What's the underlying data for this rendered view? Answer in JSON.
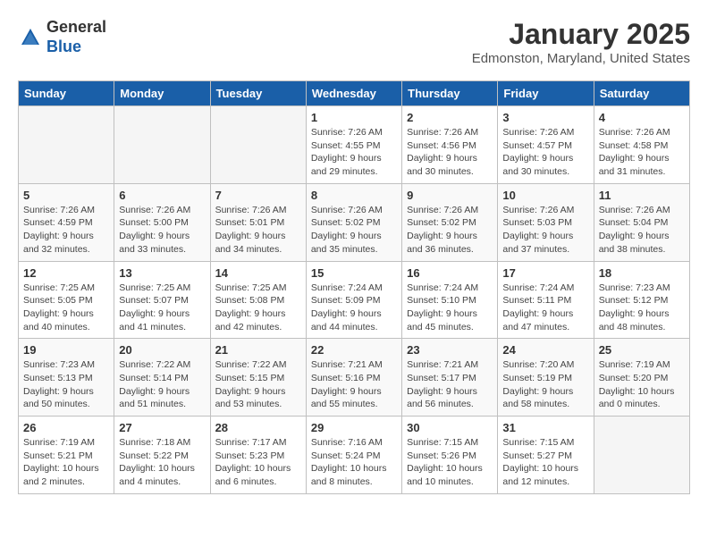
{
  "header": {
    "logo_general": "General",
    "logo_blue": "Blue",
    "month_title": "January 2025",
    "location": "Edmonston, Maryland, United States"
  },
  "columns": [
    "Sunday",
    "Monday",
    "Tuesday",
    "Wednesday",
    "Thursday",
    "Friday",
    "Saturday"
  ],
  "weeks": [
    [
      {
        "day": "",
        "info": ""
      },
      {
        "day": "",
        "info": ""
      },
      {
        "day": "",
        "info": ""
      },
      {
        "day": "1",
        "info": "Sunrise: 7:26 AM\nSunset: 4:55 PM\nDaylight: 9 hours\nand 29 minutes."
      },
      {
        "day": "2",
        "info": "Sunrise: 7:26 AM\nSunset: 4:56 PM\nDaylight: 9 hours\nand 30 minutes."
      },
      {
        "day": "3",
        "info": "Sunrise: 7:26 AM\nSunset: 4:57 PM\nDaylight: 9 hours\nand 30 minutes."
      },
      {
        "day": "4",
        "info": "Sunrise: 7:26 AM\nSunset: 4:58 PM\nDaylight: 9 hours\nand 31 minutes."
      }
    ],
    [
      {
        "day": "5",
        "info": "Sunrise: 7:26 AM\nSunset: 4:59 PM\nDaylight: 9 hours\nand 32 minutes."
      },
      {
        "day": "6",
        "info": "Sunrise: 7:26 AM\nSunset: 5:00 PM\nDaylight: 9 hours\nand 33 minutes."
      },
      {
        "day": "7",
        "info": "Sunrise: 7:26 AM\nSunset: 5:01 PM\nDaylight: 9 hours\nand 34 minutes."
      },
      {
        "day": "8",
        "info": "Sunrise: 7:26 AM\nSunset: 5:02 PM\nDaylight: 9 hours\nand 35 minutes."
      },
      {
        "day": "9",
        "info": "Sunrise: 7:26 AM\nSunset: 5:02 PM\nDaylight: 9 hours\nand 36 minutes."
      },
      {
        "day": "10",
        "info": "Sunrise: 7:26 AM\nSunset: 5:03 PM\nDaylight: 9 hours\nand 37 minutes."
      },
      {
        "day": "11",
        "info": "Sunrise: 7:26 AM\nSunset: 5:04 PM\nDaylight: 9 hours\nand 38 minutes."
      }
    ],
    [
      {
        "day": "12",
        "info": "Sunrise: 7:25 AM\nSunset: 5:05 PM\nDaylight: 9 hours\nand 40 minutes."
      },
      {
        "day": "13",
        "info": "Sunrise: 7:25 AM\nSunset: 5:07 PM\nDaylight: 9 hours\nand 41 minutes."
      },
      {
        "day": "14",
        "info": "Sunrise: 7:25 AM\nSunset: 5:08 PM\nDaylight: 9 hours\nand 42 minutes."
      },
      {
        "day": "15",
        "info": "Sunrise: 7:24 AM\nSunset: 5:09 PM\nDaylight: 9 hours\nand 44 minutes."
      },
      {
        "day": "16",
        "info": "Sunrise: 7:24 AM\nSunset: 5:10 PM\nDaylight: 9 hours\nand 45 minutes."
      },
      {
        "day": "17",
        "info": "Sunrise: 7:24 AM\nSunset: 5:11 PM\nDaylight: 9 hours\nand 47 minutes."
      },
      {
        "day": "18",
        "info": "Sunrise: 7:23 AM\nSunset: 5:12 PM\nDaylight: 9 hours\nand 48 minutes."
      }
    ],
    [
      {
        "day": "19",
        "info": "Sunrise: 7:23 AM\nSunset: 5:13 PM\nDaylight: 9 hours\nand 50 minutes."
      },
      {
        "day": "20",
        "info": "Sunrise: 7:22 AM\nSunset: 5:14 PM\nDaylight: 9 hours\nand 51 minutes."
      },
      {
        "day": "21",
        "info": "Sunrise: 7:22 AM\nSunset: 5:15 PM\nDaylight: 9 hours\nand 53 minutes."
      },
      {
        "day": "22",
        "info": "Sunrise: 7:21 AM\nSunset: 5:16 PM\nDaylight: 9 hours\nand 55 minutes."
      },
      {
        "day": "23",
        "info": "Sunrise: 7:21 AM\nSunset: 5:17 PM\nDaylight: 9 hours\nand 56 minutes."
      },
      {
        "day": "24",
        "info": "Sunrise: 7:20 AM\nSunset: 5:19 PM\nDaylight: 9 hours\nand 58 minutes."
      },
      {
        "day": "25",
        "info": "Sunrise: 7:19 AM\nSunset: 5:20 PM\nDaylight: 10 hours\nand 0 minutes."
      }
    ],
    [
      {
        "day": "26",
        "info": "Sunrise: 7:19 AM\nSunset: 5:21 PM\nDaylight: 10 hours\nand 2 minutes."
      },
      {
        "day": "27",
        "info": "Sunrise: 7:18 AM\nSunset: 5:22 PM\nDaylight: 10 hours\nand 4 minutes."
      },
      {
        "day": "28",
        "info": "Sunrise: 7:17 AM\nSunset: 5:23 PM\nDaylight: 10 hours\nand 6 minutes."
      },
      {
        "day": "29",
        "info": "Sunrise: 7:16 AM\nSunset: 5:24 PM\nDaylight: 10 hours\nand 8 minutes."
      },
      {
        "day": "30",
        "info": "Sunrise: 7:15 AM\nSunset: 5:26 PM\nDaylight: 10 hours\nand 10 minutes."
      },
      {
        "day": "31",
        "info": "Sunrise: 7:15 AM\nSunset: 5:27 PM\nDaylight: 10 hours\nand 12 minutes."
      },
      {
        "day": "",
        "info": ""
      }
    ]
  ]
}
